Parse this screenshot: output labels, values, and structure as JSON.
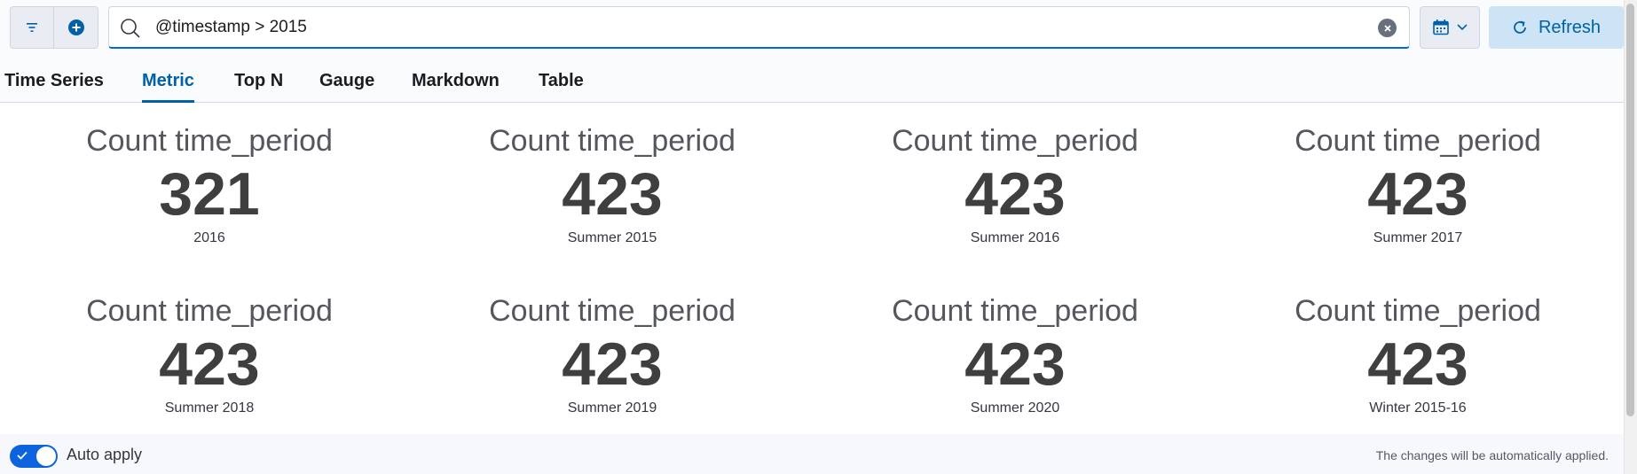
{
  "search": {
    "value": "@timestamp > 2015",
    "placeholder": ""
  },
  "toolbar": {
    "refresh_label": "Refresh"
  },
  "tabs": [
    {
      "label": "Time Series",
      "active": false
    },
    {
      "label": "Metric",
      "active": true
    },
    {
      "label": "Top N",
      "active": false
    },
    {
      "label": "Gauge",
      "active": false
    },
    {
      "label": "Markdown",
      "active": false
    },
    {
      "label": "Table",
      "active": false
    }
  ],
  "metrics": [
    {
      "title": "Count time_period",
      "value": "321",
      "label": "2016"
    },
    {
      "title": "Count time_period",
      "value": "423",
      "label": "Summer 2015"
    },
    {
      "title": "Count time_period",
      "value": "423",
      "label": "Summer 2016"
    },
    {
      "title": "Count time_period",
      "value": "423",
      "label": "Summer 2017"
    },
    {
      "title": "Count time_period",
      "value": "423",
      "label": "Summer 2018"
    },
    {
      "title": "Count time_period",
      "value": "423",
      "label": "Summer 2019"
    },
    {
      "title": "Count time_period",
      "value": "423",
      "label": "Summer 2020"
    },
    {
      "title": "Count time_period",
      "value": "423",
      "label": "Winter 2015-16"
    }
  ],
  "footer": {
    "auto_apply_label": "Auto apply",
    "auto_apply_on": true,
    "message": "The changes will be automatically applied."
  },
  "colors": {
    "accent": "#0061a6",
    "toggle": "#0b64dd",
    "refresh_bg": "#cce4f5"
  },
  "icons": {
    "filter": "filter-icon",
    "add": "plus-circle-icon",
    "search": "search-icon",
    "clear": "clear-icon",
    "calendar": "calendar-icon",
    "refresh": "refresh-icon"
  }
}
